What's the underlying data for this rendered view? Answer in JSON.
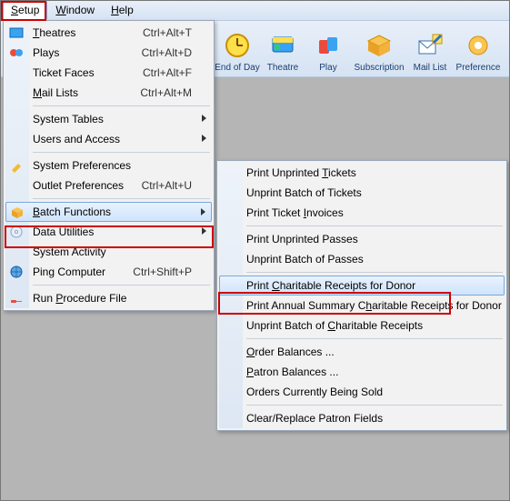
{
  "menubar": {
    "setup": "Setup",
    "window": "Window",
    "help": "Help"
  },
  "toolbar": {
    "eod": "End of Day",
    "theatre": "Theatre",
    "play": "Play",
    "subscription": "Subscription",
    "maillist": "Mail List",
    "preferences": "Preference"
  },
  "setup_menu": {
    "theatres": "Theatres",
    "theatres_accel": "Ctrl+Alt+T",
    "plays": "Plays",
    "plays_accel": "Ctrl+Alt+D",
    "ticket_faces": "Ticket Faces",
    "ticket_faces_accel": "Ctrl+Alt+F",
    "mail_lists": "Mail Lists",
    "mail_lists_accel": "Ctrl+Alt+M",
    "system_tables": "System Tables",
    "users_access": "Users and Access",
    "system_preferences": "System Preferences",
    "outlet_preferences": "Outlet Preferences",
    "outlet_preferences_accel": "Ctrl+Alt+U",
    "batch_functions": "Batch Functions",
    "data_utilities": "Data Utilities",
    "system_activity": "System Activity",
    "ping": "Ping Computer",
    "ping_accel": "Ctrl+Shift+P",
    "run_procedure": "Run Procedure File"
  },
  "batch_menu": {
    "print_unprinted_tickets": "Print Unprinted Tickets",
    "unprint_batch_tickets": "Unprint Batch of Tickets",
    "print_ticket_invoices": "Print Ticket Invoices",
    "print_unprinted_passes": "Print Unprinted Passes",
    "unprint_batch_passes": "Unprint Batch of Passes",
    "print_charitable": "Print Charitable Receipts for Donor",
    "print_annual_summary": "Print Annual Summary Charitable Receipts for Donor",
    "unprint_charitable": "Unprint Batch of Charitable Receipts",
    "order_balances": "Order Balances ...",
    "patron_balances": "Patron Balances ...",
    "orders_being_sold": "Orders Currently Being Sold",
    "clear_replace": "Clear/Replace Patron Fields"
  },
  "highlights": {
    "setup_menu_item": "Setup",
    "batch_functions_item": "Batch Functions",
    "print_charitable_item": "Print Charitable Receipts for Donor"
  }
}
